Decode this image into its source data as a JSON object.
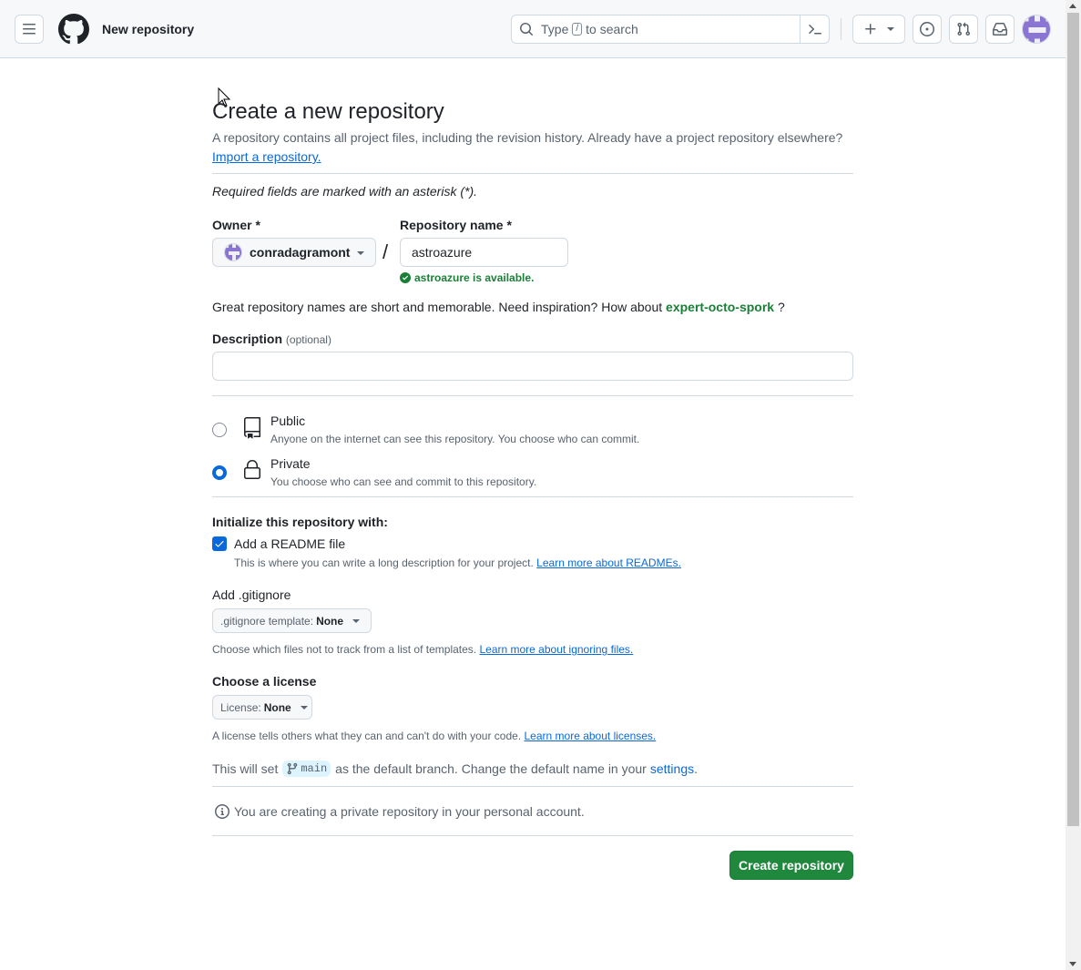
{
  "header": {
    "context": "New repository",
    "search_text_before": "Type",
    "search_key": "/",
    "search_text_after": "to search",
    "icons": [
      "hamburger-icon",
      "github-logo-icon",
      "search-icon",
      "command-palette-icon",
      "plus-icon",
      "issues-icon",
      "pull-requests-icon",
      "inbox-icon"
    ]
  },
  "page": {
    "title": "Create a new repository",
    "lead": "A repository contains all project files, including the revision history. Already have a project repository elsewhere?",
    "import_link": "Import a repository.",
    "required_note": "Required fields are marked with an asterisk (*)."
  },
  "owner": {
    "label": "Owner *",
    "value": "conradagramont"
  },
  "repo_name": {
    "label": "Repository name *",
    "value": "astroazure",
    "availability": "astroazure is available."
  },
  "inspiration": {
    "text": "Great repository names are short and memorable. Need inspiration? How about",
    "suggestion": "expert-octo-spork",
    "end": "?"
  },
  "description": {
    "label": "Description",
    "optional": "(optional)",
    "value": ""
  },
  "visibility": {
    "selected": "private",
    "public_title": "Public",
    "public_desc": "Anyone on the internet can see this repository. You choose who can commit.",
    "private_title": "Private",
    "private_desc": "You choose who can see and commit to this repository."
  },
  "init": {
    "heading": "Initialize this repository with:",
    "readme_label": "Add a README file",
    "readme_checked": true,
    "readme_note": "This is where you can write a long description for your project.",
    "readme_link": "Learn more about READMEs."
  },
  "gitignore": {
    "heading": "Add .gitignore",
    "select_prefix": ".gitignore template:",
    "select_value": "None",
    "note": "Choose which files not to track from a list of templates.",
    "link": "Learn more about ignoring files."
  },
  "license": {
    "heading": "Choose a license",
    "select_prefix": "License:",
    "select_value": "None",
    "note": "A license tells others what they can and can't do with your code.",
    "link": "Learn more about licenses."
  },
  "branch": {
    "before": "This will set",
    "name": "main",
    "after": "as the default branch. Change the default name in your",
    "settings_link": "settings",
    "end": "."
  },
  "info": {
    "text": "You are creating a private repository in your personal account."
  },
  "actions": {
    "create_label": "Create repository"
  },
  "colors": {
    "primary_button": "#1f883d",
    "link": "#0969da",
    "success": "#1a7f37",
    "avatar": "#8a75d3"
  }
}
